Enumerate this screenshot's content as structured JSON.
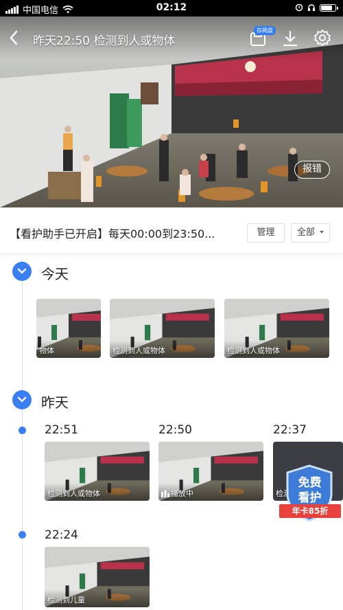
{
  "status_bar": {
    "carrier": "中国电信",
    "time": "02:12"
  },
  "video": {
    "title": "昨天22:50 检测到人或物体",
    "cloud_badge": "存网盘",
    "report_label": "报错"
  },
  "guard": {
    "status_text": "【看护助手已开启】每天00:00到23:50...",
    "manage_label": "管理",
    "filter_label": "全部"
  },
  "timeline": {
    "today": {
      "label": "今天",
      "clips": [
        {
          "caption": "物体"
        },
        {
          "caption": "检测到人或物体"
        },
        {
          "caption": "检测到人或物体"
        }
      ]
    },
    "yesterday": {
      "label": "昨天",
      "clips": [
        {
          "time": "22:51",
          "caption": "检测到人或物体"
        },
        {
          "time": "22:50",
          "caption": "播放中"
        },
        {
          "time": "22:37",
          "caption": "检测"
        },
        {
          "time": "22:24",
          "caption": "检测到儿童"
        }
      ]
    }
  },
  "promo": {
    "line1": "免费",
    "line2": "看护",
    "ribbon": "年卡85折",
    "colors": {
      "shield": "#3d7bd8",
      "ribbon": "#e8413b"
    }
  },
  "colors": {
    "accent": "#3b7ff5",
    "timeline": "#d6dde6"
  }
}
